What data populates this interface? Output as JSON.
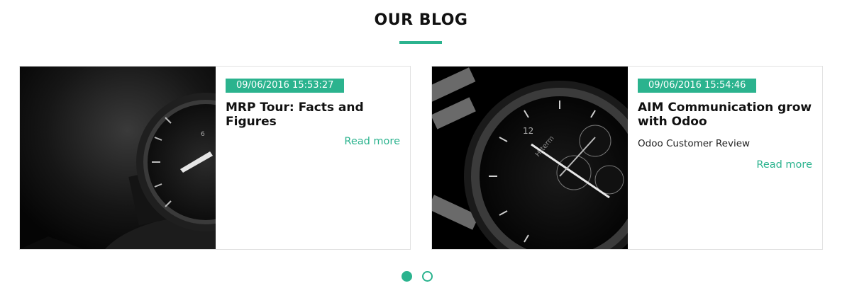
{
  "section": {
    "title": "OUR BLOG",
    "accent_color": "#2bb38e"
  },
  "posts": [
    {
      "date": "09/06/2016 15:53:27",
      "title": "MRP Tour: Facts and Figures",
      "excerpt": "",
      "read_more": "Read more",
      "image": "black-watch-photo"
    },
    {
      "date": "09/06/2016 15:54:46",
      "title": "AIM Communication grow with Odoo",
      "excerpt": "Odoo Customer Review",
      "read_more": "Read more",
      "image": "chronograph-watch-photo"
    }
  ],
  "carousel": {
    "page_count": 2,
    "active_index": 0
  }
}
